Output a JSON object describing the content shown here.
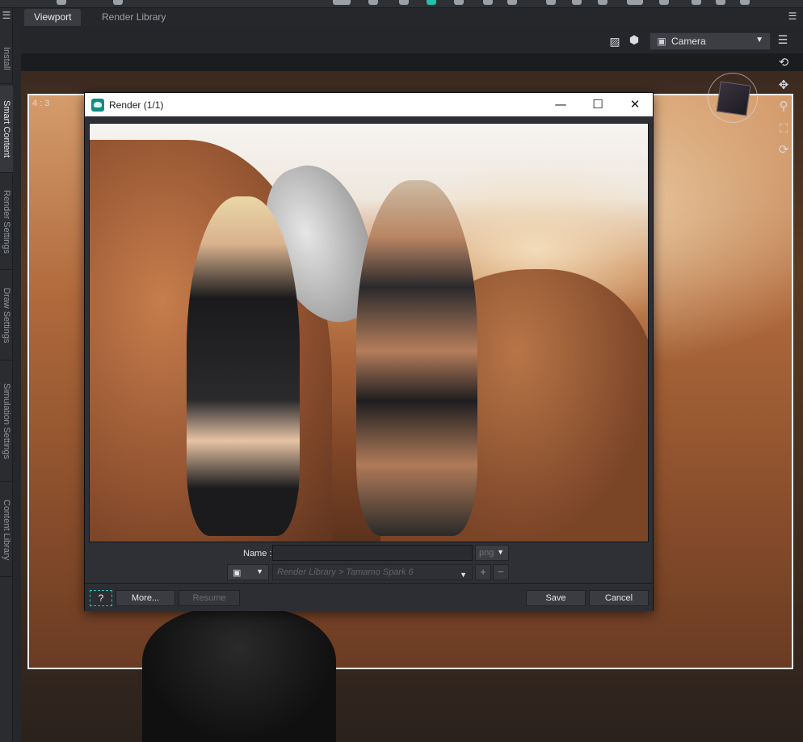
{
  "tabs": {
    "viewport": "Viewport",
    "render_library": "Render Library"
  },
  "side_tabs": [
    "Install",
    "Smart Content",
    "Render Settings",
    "Draw Settings",
    "Simulation Settings",
    "Content Library"
  ],
  "viewport": {
    "camera_label": "Camera",
    "frame_aspect": "4 : 3"
  },
  "render_window": {
    "title": "Render (1/1)",
    "name_label": "Name :",
    "name_value": "",
    "extension": "png",
    "path": "Render Library > Tamamo Spark 6",
    "add_label": "+",
    "remove_label": "−",
    "help_label": "?",
    "more_label": "More...",
    "resume_label": "Resume",
    "save_label": "Save",
    "cancel_label": "Cancel"
  },
  "colors": {
    "accent": "#19c2b0",
    "titlebar": "#ffffff",
    "panel": "#2e3035"
  }
}
